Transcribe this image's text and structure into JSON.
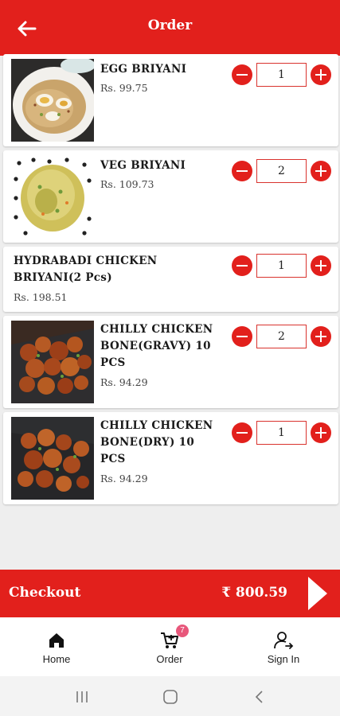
{
  "header": {
    "title": "Order",
    "back_icon": "back-arrow-icon",
    "color": "#e2201c"
  },
  "items": [
    {
      "name_lines": [
        "EGG BRIYANI"
      ],
      "price": "Rs. 99.75",
      "quantity": "1",
      "has_image": true,
      "image": "egg-briyani-photo"
    },
    {
      "name_lines": [
        "VEG BRIYANI"
      ],
      "price": "Rs. 109.73",
      "quantity": "2",
      "has_image": true,
      "image": "veg-briyani-photo"
    },
    {
      "name_lines": [
        "HYDRABADI CHICKEN",
        "BRIYANI(2 Pcs)"
      ],
      "price": "Rs. 198.51",
      "quantity": "1",
      "has_image": false
    },
    {
      "name_lines": [
        "CHILLY CHICKEN",
        "BONE(GRAVY) 10",
        "PCS"
      ],
      "price": "Rs. 94.29",
      "quantity": "2",
      "has_image": true,
      "image": "chilly-chicken-gravy-photo"
    },
    {
      "name_lines": [
        "CHILLY CHICKEN",
        "BONE(DRY) 10",
        "PCS"
      ],
      "price": "Rs. 94.29",
      "quantity": "1",
      "has_image": true,
      "image": "chilly-chicken-dry-photo"
    }
  ],
  "checkout": {
    "label": "Checkout",
    "total": "₹ 800.59",
    "arrow_icon": "play-arrow-icon"
  },
  "bottom_nav": {
    "items": [
      {
        "label": "Home",
        "icon": "home-icon"
      },
      {
        "label": "Order",
        "icon": "cart-icon",
        "badge": "7"
      },
      {
        "label": "Sign In",
        "icon": "person-signin-icon"
      }
    ]
  },
  "system_nav": [
    "recents-icon",
    "home-circle-icon",
    "back-chevron-icon"
  ]
}
